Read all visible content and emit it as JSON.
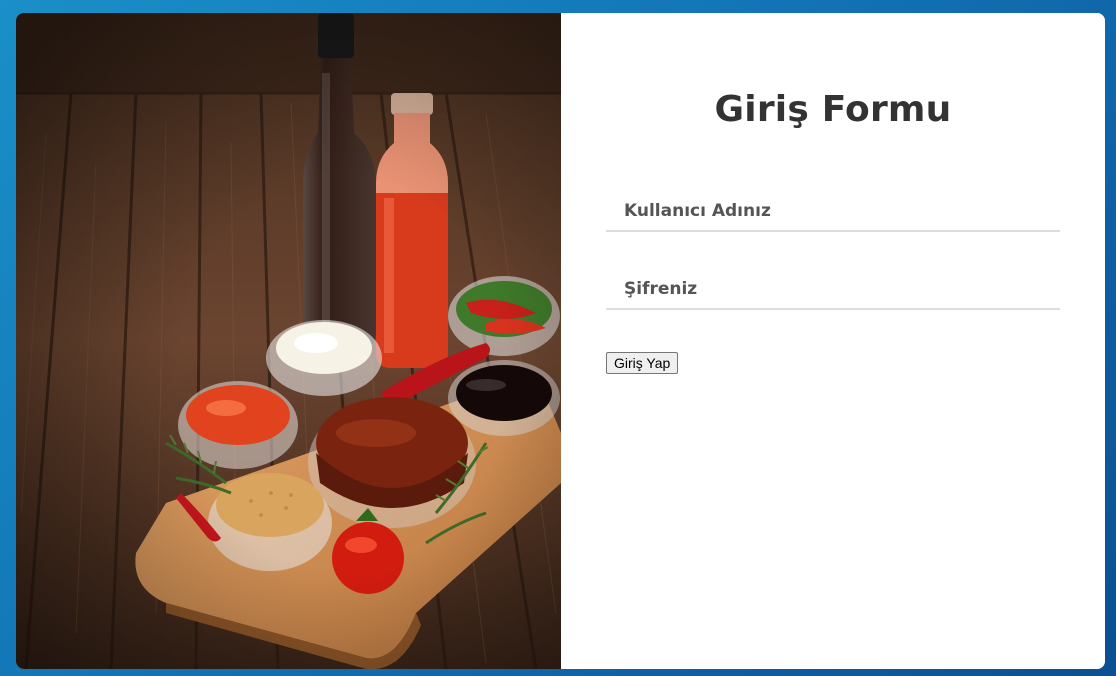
{
  "photo": {
    "description_icon": "food-photo-sauces"
  },
  "form": {
    "title": "Giriş Formu",
    "username_placeholder": "Kullanıcı Adınız",
    "username_value": "",
    "password_placeholder": "Şifreniz",
    "password_value": "",
    "submit_label": "Giriş Yap"
  },
  "colors": {
    "background_start": "#1a8fc8",
    "background_end": "#0c4f93",
    "panel": "#ffffff",
    "title": "#333333",
    "field_text": "#555555",
    "field_border": "#dddddd"
  }
}
